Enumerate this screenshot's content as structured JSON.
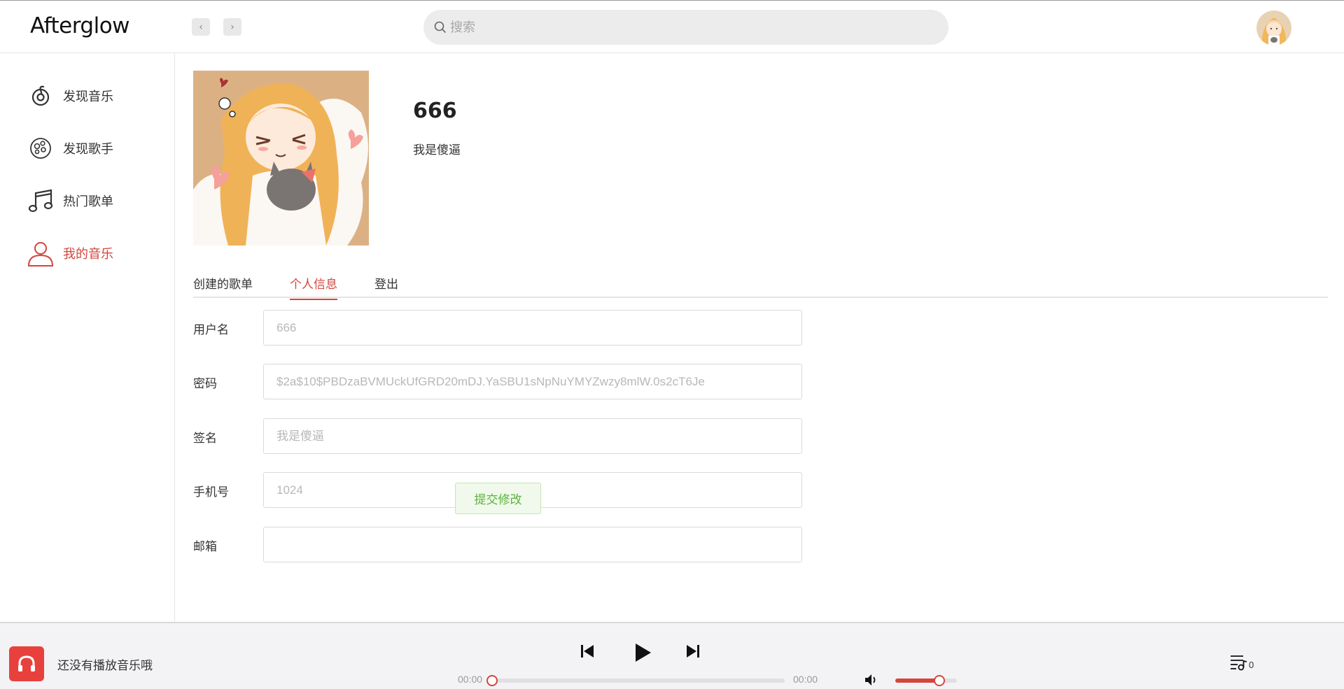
{
  "app": {
    "logo": "Afterglow"
  },
  "header": {
    "search_placeholder": "搜索"
  },
  "sidebar": {
    "items": [
      {
        "label": "发现音乐",
        "icon": "netease-music-icon",
        "active": false
      },
      {
        "label": "发现歌手",
        "icon": "singer-disc-icon",
        "active": false
      },
      {
        "label": "热门歌单",
        "icon": "music-note-icon",
        "active": false
      },
      {
        "label": "我的音乐",
        "icon": "user-icon",
        "active": true
      }
    ]
  },
  "profile": {
    "name": "666",
    "signature": "我是傻逼"
  },
  "tabs": [
    {
      "label": "创建的歌单",
      "active": false
    },
    {
      "label": "个人信息",
      "active": true
    },
    {
      "label": "登出",
      "active": false
    }
  ],
  "form": {
    "fields": [
      {
        "label": "用户名",
        "placeholder": "666"
      },
      {
        "label": "密码",
        "placeholder": "$2a$10$PBDzaBVMUckUfGRD20mDJ.YaSBU1sNpNuYMYZwzy8mlW.0s2cT6Je"
      },
      {
        "label": "签名",
        "placeholder": "我是傻逼"
      },
      {
        "label": "手机号",
        "placeholder": "1024"
      },
      {
        "label": "邮箱",
        "placeholder": ""
      }
    ],
    "submit_label": "提交修改"
  },
  "player": {
    "now_playing": "还没有播放音乐哦",
    "current_time": "00:00",
    "duration": "00:00",
    "progress": 0,
    "volume": 0.72,
    "playlist_count": "0"
  },
  "colors": {
    "accent": "#d4453e",
    "submit_text": "#5bb43a",
    "player_bg": "#f3f3f5"
  }
}
